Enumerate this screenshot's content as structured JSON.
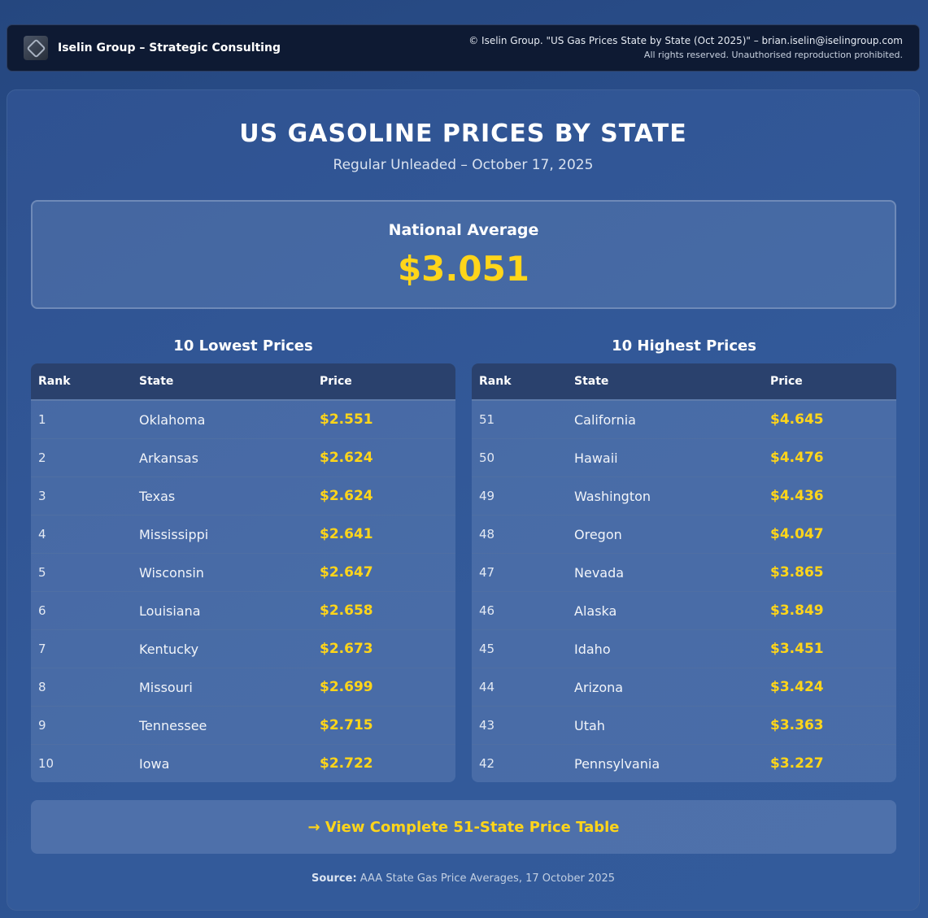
{
  "header": {
    "brand": "Iselin Group – Strategic Consulting",
    "copyright": "© Iselin Group. \"US Gas Prices State by State (Oct 2025)\" – brian.iselin@iselingroup.com",
    "rights": "All rights reserved. Unauthorised reproduction prohibited."
  },
  "main": {
    "title": "US GASOLINE PRICES BY STATE",
    "subtitle": "Regular Unleaded – October 17, 2025",
    "national_average": {
      "label": "National Average",
      "value": "$3.051"
    }
  },
  "lowest": {
    "title": "10 Lowest Prices",
    "columns": [
      "Rank",
      "State",
      "Price"
    ],
    "rows": [
      {
        "rank": "1",
        "state": "Oklahoma",
        "price": "$2.551"
      },
      {
        "rank": "2",
        "state": "Arkansas",
        "price": "$2.624"
      },
      {
        "rank": "3",
        "state": "Texas",
        "price": "$2.624"
      },
      {
        "rank": "4",
        "state": "Mississippi",
        "price": "$2.641"
      },
      {
        "rank": "5",
        "state": "Wisconsin",
        "price": "$2.647"
      },
      {
        "rank": "6",
        "state": "Louisiana",
        "price": "$2.658"
      },
      {
        "rank": "7",
        "state": "Kentucky",
        "price": "$2.673"
      },
      {
        "rank": "8",
        "state": "Missouri",
        "price": "$2.699"
      },
      {
        "rank": "9",
        "state": "Tennessee",
        "price": "$2.715"
      },
      {
        "rank": "10",
        "state": "Iowa",
        "price": "$2.722"
      }
    ]
  },
  "highest": {
    "title": "10 Highest Prices",
    "columns": [
      "Rank",
      "State",
      "Price"
    ],
    "rows": [
      {
        "rank": "51",
        "state": "California",
        "price": "$4.645"
      },
      {
        "rank": "50",
        "state": "Hawaii",
        "price": "$4.476"
      },
      {
        "rank": "49",
        "state": "Washington",
        "price": "$4.436"
      },
      {
        "rank": "48",
        "state": "Oregon",
        "price": "$4.047"
      },
      {
        "rank": "47",
        "state": "Nevada",
        "price": "$3.865"
      },
      {
        "rank": "46",
        "state": "Alaska",
        "price": "$3.849"
      },
      {
        "rank": "45",
        "state": "Idaho",
        "price": "$3.451"
      },
      {
        "rank": "44",
        "state": "Arizona",
        "price": "$3.424"
      },
      {
        "rank": "43",
        "state": "Utah",
        "price": "$3.363"
      },
      {
        "rank": "42",
        "state": "Pennsylvania",
        "price": "$3.227"
      }
    ]
  },
  "cta": {
    "label": "→ View Complete 51-State Price Table"
  },
  "footer": {
    "source_label": "Source:",
    "source_text": "AAA State Gas Price Averages, 17 October 2025"
  },
  "colors": {
    "accent": "#ffd51a",
    "background": "#2b4f8d",
    "header": "#0e1a33"
  }
}
